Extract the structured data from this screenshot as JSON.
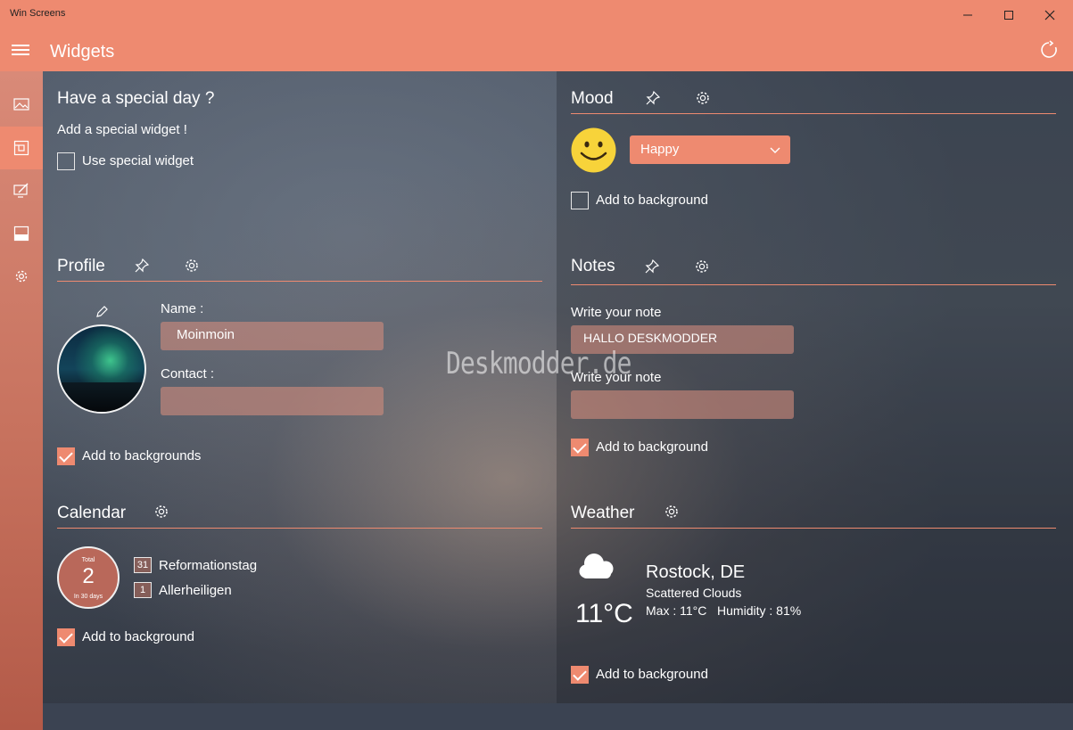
{
  "window": {
    "title": "Win Screens"
  },
  "header": {
    "title": "Widgets"
  },
  "rail": {
    "items": [
      "image-icon",
      "widgets-icon",
      "edit-monitor-icon",
      "taskbar-icon",
      "gear-icon"
    ]
  },
  "special": {
    "title": "Have a special day ?",
    "subtitle": "Add a special widget !",
    "checkbox_label": "Use special widget",
    "checked": false
  },
  "profile": {
    "title": "Profile",
    "name_label": "Name :",
    "name_value": "Moinmoin",
    "contact_label": "Contact :",
    "contact_value": "",
    "checkbox_label": "Add to backgrounds",
    "checked": true
  },
  "calendar": {
    "title": "Calendar",
    "total_label": "Total",
    "total": "2",
    "period": "In 30 days",
    "events": [
      {
        "day": "31",
        "name": "Reformationstag"
      },
      {
        "day": "1",
        "name": "Allerheiligen"
      }
    ],
    "checkbox_label": "Add to background",
    "checked": true
  },
  "mood": {
    "title": "Mood",
    "selected": "Happy",
    "checkbox_label": "Add to background",
    "checked": false
  },
  "notes": {
    "title": "Notes",
    "note1_label": "Write your note",
    "note1_value": "HALLO DESKMODDER",
    "note2_label": "Write your note",
    "note2_value": "",
    "checkbox_label": "Add to background",
    "checked": true
  },
  "weather": {
    "title": "Weather",
    "location": "Rostock, DE",
    "condition": "Scattered Clouds",
    "temperature": "11°C",
    "details": "Max : 11°C   Humidity : 81%",
    "checkbox_label": "Add to background",
    "checked": true
  },
  "watermark": "Deskmodder.de",
  "colors": {
    "accent": "#ee8a70",
    "rail": "#c7725e"
  }
}
